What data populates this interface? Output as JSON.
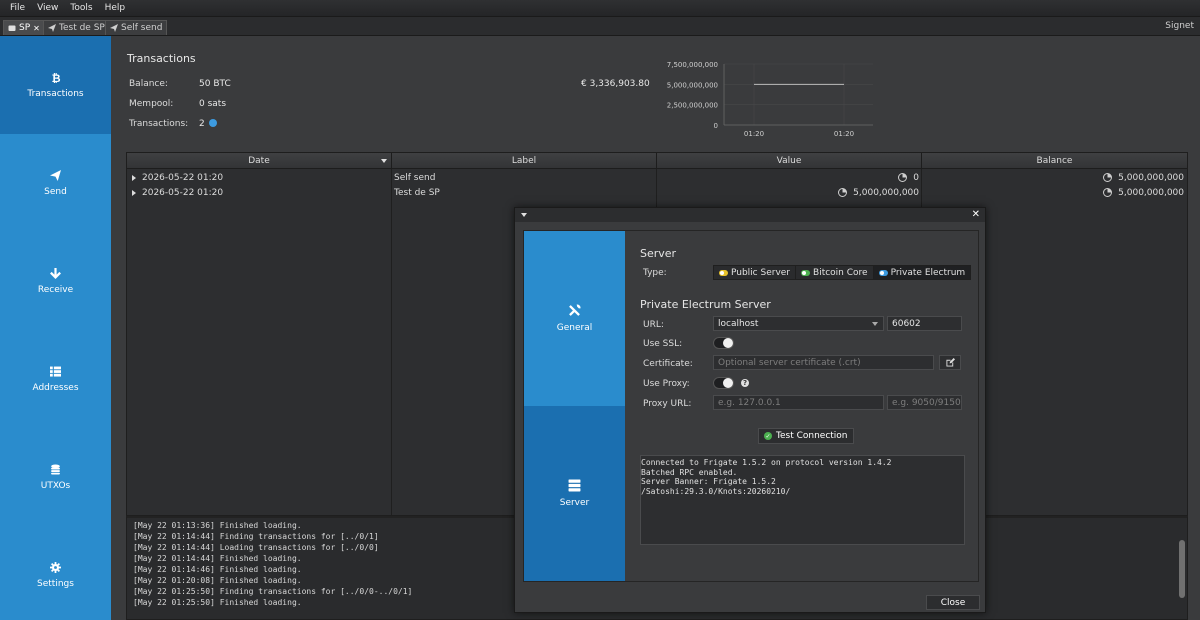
{
  "menu": [
    "File",
    "View",
    "Tools",
    "Help"
  ],
  "tabs": [
    {
      "label": "SP",
      "close": "✕"
    },
    {
      "label": "Test de SP"
    },
    {
      "label": "Self send"
    }
  ],
  "network": "Signet",
  "sidebar": [
    "Transactions",
    "Send",
    "Receive",
    "Addresses",
    "UTXOs",
    "Settings"
  ],
  "summary": {
    "title": "Transactions",
    "balance_label": "Balance:",
    "balance_value": "50 BTC",
    "fiat_value": "€ 3,336,903.80",
    "mempool_label": "Mempool:",
    "mempool_value": "0 sats",
    "tx_label": "Transactions:",
    "tx_value": "2"
  },
  "chart_data": {
    "type": "line",
    "x": [
      "01:20",
      "01:20"
    ],
    "series": [
      {
        "values": [
          5000000000,
          5000000000
        ]
      }
    ],
    "yticks": [
      "7,500,000,000",
      "5,000,000,000",
      "2,500,000,000",
      "0"
    ],
    "ylim": [
      0,
      7500000000
    ],
    "grid": true
  },
  "table": {
    "headers": [
      "Date",
      "Label",
      "Value",
      "Balance"
    ],
    "rows": [
      {
        "date": "2026-05-22 01:20",
        "label": "Self send",
        "value": "0",
        "balance": "5,000,000,000"
      },
      {
        "date": "2026-05-22 01:20",
        "label": "Test de SP",
        "value": "5,000,000,000",
        "balance": "5,000,000,000"
      }
    ]
  },
  "log": [
    "[May 22 01:13:36] Finished loading.",
    "[May 22 01:14:44] Finding transactions for [../0/1]",
    "[May 22 01:14:44] Loading transactions for [../0/0]",
    "[May 22 01:14:44] Finished loading.",
    "[May 22 01:14:46] Finished loading.",
    "[May 22 01:20:08] Finished loading.",
    "[May 22 01:25:50] Finding transactions for [../0/0-../0/1]",
    "[May 22 01:25:50] Finished loading."
  ],
  "dialog": {
    "close": "✕",
    "nav": [
      "General",
      "Server"
    ],
    "server_heading": "Server",
    "type_label": "Type:",
    "types": [
      "Public Server",
      "Bitcoin Core",
      "Private Electrum"
    ],
    "type_colors": [
      "#e6c12a",
      "#4cb050",
      "#3d9be0"
    ],
    "private_heading": "Private Electrum Server",
    "url_label": "URL:",
    "url_value": "localhost",
    "port_value": "60602",
    "ssl_label": "Use SSL:",
    "cert_label": "Certificate:",
    "cert_placeholder": "Optional server certificate (.crt)",
    "proxy_label": "Use Proxy:",
    "help": "?",
    "proxy_url_label": "Proxy URL:",
    "proxy_host_placeholder": "e.g. 127.0.0.1",
    "proxy_port_placeholder": "e.g. 9050/9150",
    "test_label": "Test Connection",
    "output": [
      "Connected to Frigate 1.5.2 on protocol version 1.4.2",
      "Batched RPC enabled.",
      "Server Banner: Frigate 1.5.2",
      "/Satoshi:29.3.0/Knots:20260210/"
    ],
    "close_label": "Close"
  }
}
